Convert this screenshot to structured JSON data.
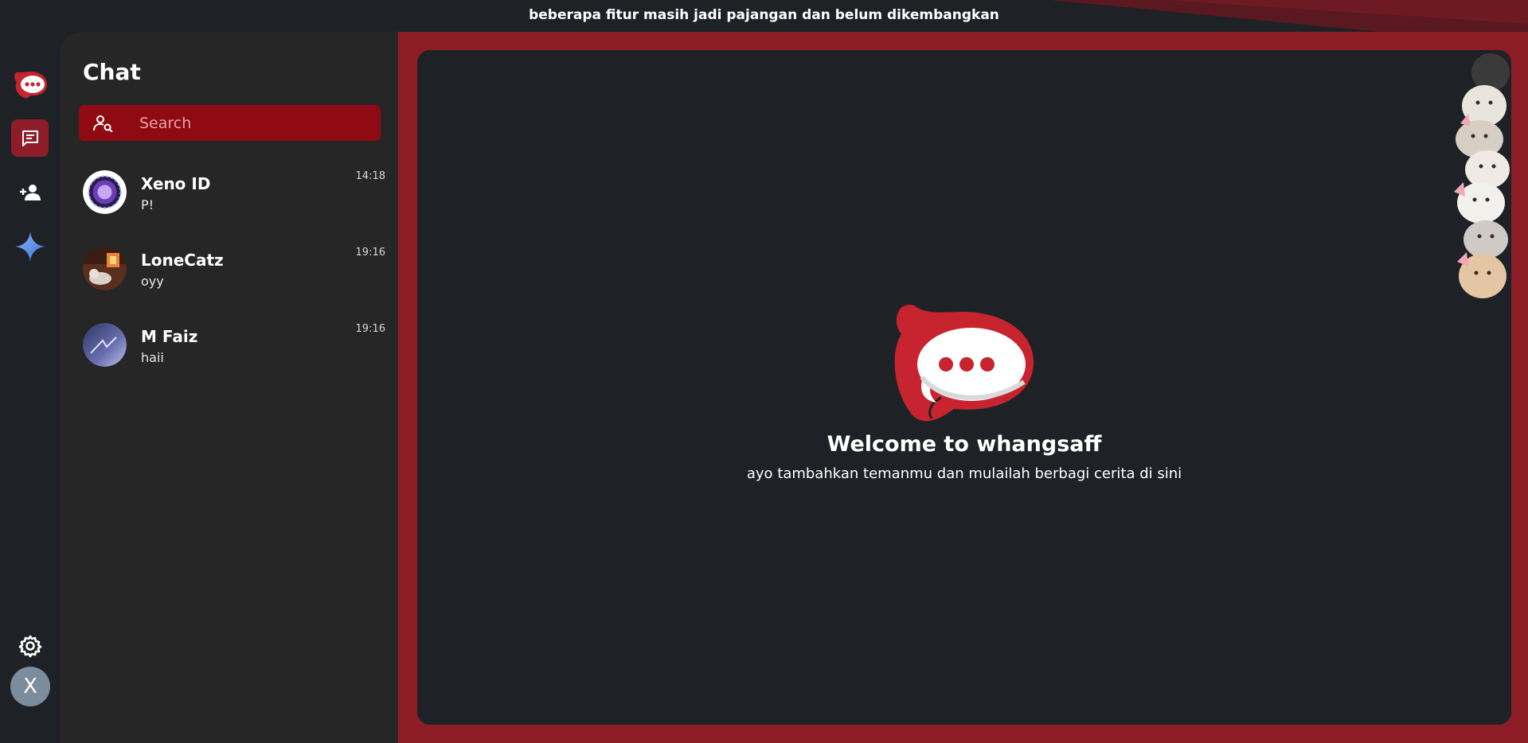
{
  "banner": {
    "text": "beberapa fitur masih jadi pajangan dan belum dikembangkan",
    "accent": "#8c1d27"
  },
  "rail": {
    "items": [
      {
        "name": "app-logo",
        "icon": "chat-bubble-logo-icon",
        "active": false
      },
      {
        "name": "chats",
        "icon": "message-square-icon",
        "active": true
      },
      {
        "name": "add-contact",
        "icon": "person-add-icon",
        "active": false
      },
      {
        "name": "ai-assistant",
        "icon": "sparkle-icon",
        "active": false
      }
    ],
    "settings_icon": "gear-icon",
    "user_initial": "X"
  },
  "sidebar": {
    "title": "Chat",
    "search": {
      "placeholder": "Search",
      "icon": "person-search-icon"
    },
    "chats": [
      {
        "name": "Xeno ID",
        "last_message": "P!",
        "time": "14:18"
      },
      {
        "name": "LoneCatz",
        "last_message": "oyy",
        "time": "19:16"
      },
      {
        "name": "M Faiz",
        "last_message": "haii",
        "time": "19:16"
      }
    ]
  },
  "main": {
    "title": "Welcome to whangsaff",
    "subtitle": "ayo tambahkan temanmu dan mulailah berbagi cerita di sini"
  },
  "colors": {
    "background": "#1e2226",
    "sidebar": "#262626",
    "accent": "#8c1d27",
    "search_bg": "#8f0a12",
    "brand_red": "#c8242f"
  }
}
